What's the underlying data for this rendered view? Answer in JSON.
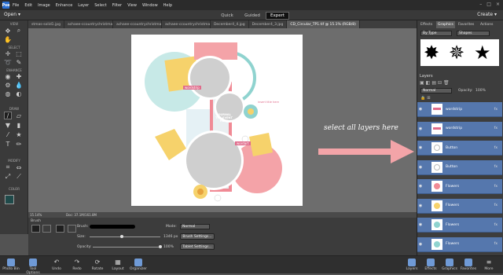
{
  "menu": [
    "File",
    "Edit",
    "Image",
    "Enhance",
    "Layer",
    "Select",
    "Filter",
    "View",
    "Window",
    "Help"
  ],
  "app_logo": "Pse",
  "modebar": {
    "open": "Open",
    "modes": [
      "Quick",
      "Guided",
      "Expert"
    ],
    "active": "Expert",
    "create": "Create"
  },
  "tabs": [
    "stmas-solid1.jpg",
    "achaee-ccountrychristmas-solid7.jpg",
    "achaee-ccountrychristmas-solid3.jpg",
    "achaee-ccountrychristmas-solid4.jpg",
    "December4_4.jpg",
    "December4_3.jpg",
    "CD_Circular_TP1.tif @ 15.1% (RGB/8)"
  ],
  "toolbox": {
    "sections": [
      "VIEW",
      "SELECT",
      "ENHANCE",
      "DRAW",
      "MODIFY",
      "COLOR"
    ]
  },
  "document": {
    "journal_text": "JOURNAL THE EVENT HERE",
    "wordstrip_text": "wordstrip",
    "title_text": "insert title here",
    "wordart_text": "wordart"
  },
  "annotation": {
    "text": "select all layers here",
    "color": "#f3a4a8"
  },
  "status": {
    "zoom": "15.14%",
    "doc": "Doc: 37.1M/161.8M"
  },
  "tool_options": {
    "brush_label": "Brush",
    "brush_field": "Brush:",
    "size_label": "Size:",
    "size_value": "1346 px",
    "size_level": 0.45,
    "opacity_label": "Opacity:",
    "opacity_value": "100%",
    "opacity_level": 1.0,
    "mode_label": "Mode:",
    "mode_value": "Normal",
    "brush_settings": "Brush Settings...",
    "tablet_settings": "Tablet Settings..."
  },
  "panel": {
    "tabs": [
      "Effects",
      "Graphics",
      "Favorites",
      "Actions"
    ],
    "active_tab": "Graphics",
    "filter_type": "By Type",
    "filter_value": "Shapes",
    "layers_title": "Layers",
    "blend_mode": "Normal",
    "opacity_label": "Opacity:",
    "opacity_value": "100%",
    "layers": [
      {
        "name": "wordstrip",
        "thumb": "wordstrip"
      },
      {
        "name": "wordstrip",
        "thumb": "wordstrip"
      },
      {
        "name": "Button",
        "thumb": "button"
      },
      {
        "name": "Button",
        "thumb": "button"
      },
      {
        "name": "Flowers",
        "thumb": "flower-pink"
      },
      {
        "name": "Flowers",
        "thumb": "flower-yellow"
      },
      {
        "name": "Flowers",
        "thumb": "flower-teal"
      },
      {
        "name": "Flowers",
        "thumb": "flower-teal"
      }
    ],
    "selected_color": "#5577ad"
  },
  "taskbar": {
    "left": [
      "Photo Bin",
      "Tool Options"
    ],
    "center": [
      "Undo",
      "Redo",
      "Rotate",
      "Layout",
      "Organizer"
    ],
    "right": [
      "Layers",
      "Effects",
      "Graphics",
      "Favorites",
      "More"
    ]
  }
}
